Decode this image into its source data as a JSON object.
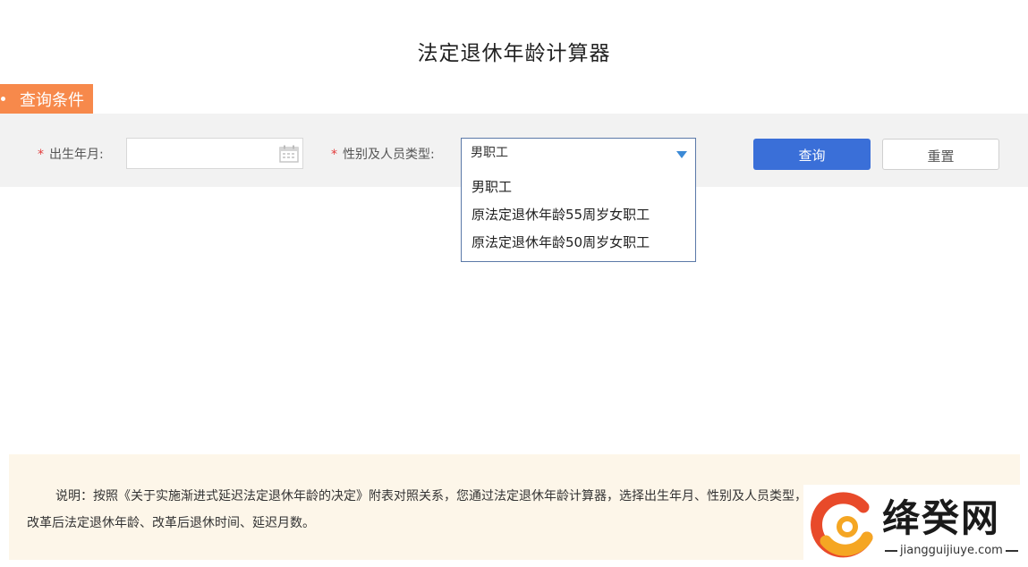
{
  "page": {
    "title": "法定退休年龄计算器"
  },
  "section": {
    "label": "查询条件"
  },
  "form": {
    "birth": {
      "required_mark": "*",
      "label": "出生年月:",
      "value": ""
    },
    "type": {
      "required_mark": "*",
      "label": "性别及人员类型:",
      "selected": "男职工",
      "options": [
        "男职工",
        "原法定退休年龄55周岁女职工",
        "原法定退休年龄50周岁女职工"
      ]
    },
    "query_label": "查询",
    "reset_label": "重置"
  },
  "note": {
    "line1": "说明：按照《关于实施渐进式延迟法定退休年龄的决定》附表对照关系，您通过法定退休年龄计算器，选择出生年月、性别及人员类型，",
    "line2": "改革后法定退休年龄、改革后退休时间、延迟月数。"
  },
  "watermark": {
    "text": "绛癸网",
    "sub": "jiangguijiuye.com"
  },
  "colors": {
    "accent": "#f7894b",
    "primary": "#3a6fd8",
    "required": "#e23c3c",
    "note_bg": "#fdf6e9"
  },
  "icons": [
    "calendar-icon",
    "chevron-down-icon"
  ]
}
